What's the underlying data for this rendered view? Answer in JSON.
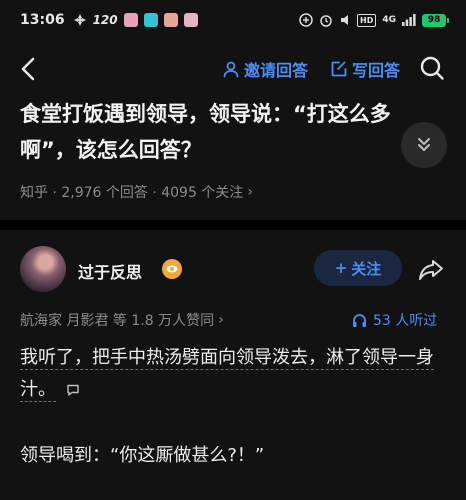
{
  "status_bar": {
    "time": "13:06",
    "network_speed": "120",
    "network_gen": "4G",
    "battery": "98"
  },
  "nav": {
    "invite_label": "邀请回答",
    "write_label": "写回答"
  },
  "question": {
    "title": "食堂打饭遇到领导，领导说：“打这么多啊”，该怎么回答？",
    "meta": "知乎 · 2,976 个回答 · 4095 个关注",
    "meta_arrow": "›"
  },
  "author": {
    "name": "过于反思",
    "follow_label": "关注",
    "follow_plus": "+",
    "endorsement": "航海家 月影君 等 1.8 万人赞同",
    "endorsement_arrow": "›",
    "listen_label": "53 人听过"
  },
  "answer": {
    "paragraphs": [
      "我听了，把手中热汤劈面向领导泼去，淋了领导一身汁。",
      "领导喝到：“你这厮做甚么?！”"
    ]
  },
  "colors": {
    "accent": "#4e8df5",
    "background": "#121212",
    "battery": "#27c46b",
    "badge": "#f2a93b"
  },
  "icons": [
    "back-arrow-icon",
    "person-icon",
    "edit-icon",
    "search-icon",
    "double-chevron-down-icon",
    "eye-badge-icon",
    "share-arrow-icon",
    "headphones-icon",
    "comment-icon"
  ]
}
